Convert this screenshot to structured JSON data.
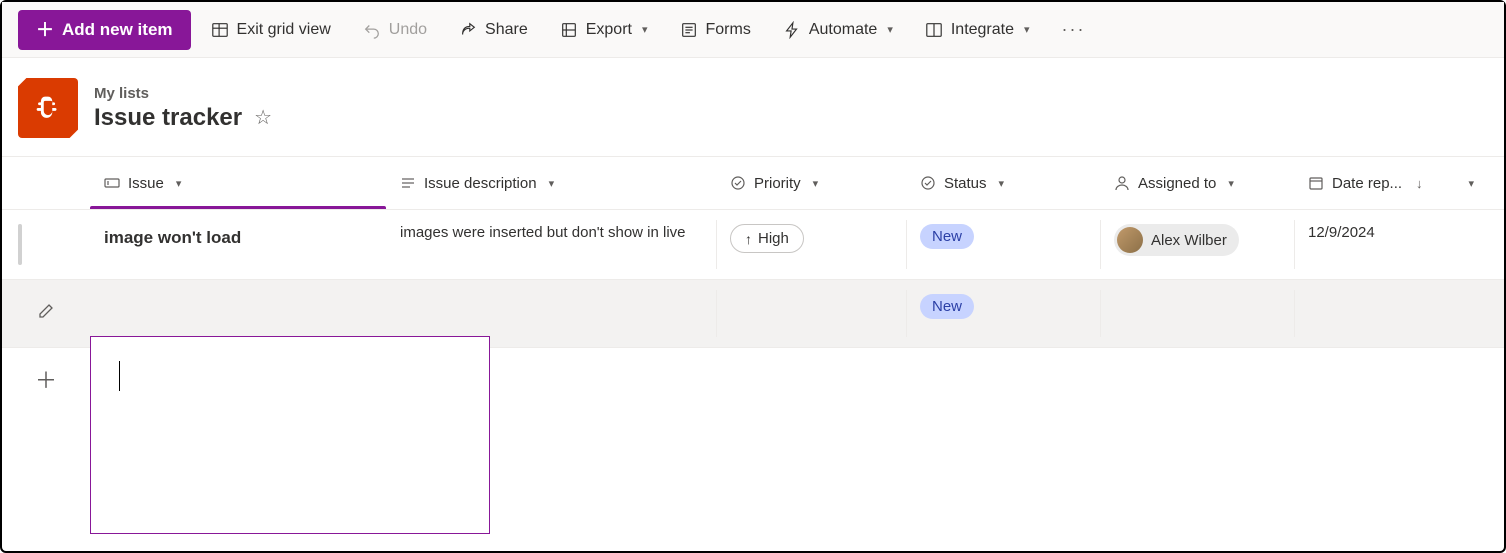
{
  "toolbar": {
    "add_label": "Add new item",
    "exit_grid": "Exit grid view",
    "undo": "Undo",
    "share": "Share",
    "export": "Export",
    "forms": "Forms",
    "automate": "Automate",
    "integrate": "Integrate"
  },
  "header": {
    "breadcrumb": "My lists",
    "title": "Issue tracker"
  },
  "columns": {
    "issue": "Issue",
    "description": "Issue description",
    "priority": "Priority",
    "status": "Status",
    "assigned": "Assigned to",
    "date": "Date rep..."
  },
  "rows": [
    {
      "issue": "image won't load",
      "description": "images were inserted but don't show in live",
      "priority": "High",
      "status": "New",
      "assigned": "Alex Wilber",
      "date": "12/9/2024"
    },
    {
      "issue": "",
      "description": "",
      "priority": "",
      "status": "New",
      "assigned": "",
      "date": ""
    }
  ]
}
